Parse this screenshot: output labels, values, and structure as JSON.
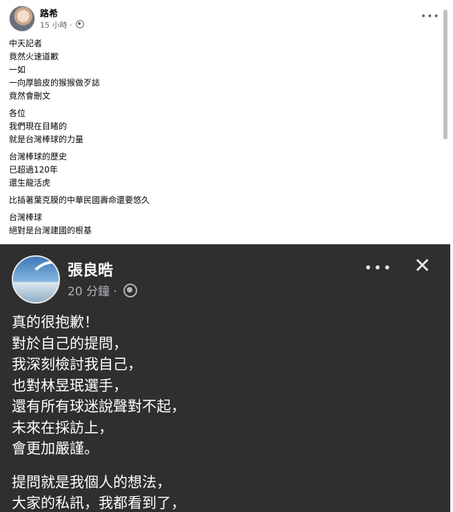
{
  "post": {
    "author": "路希",
    "time": "15 小時",
    "separator": "·",
    "more": "•••",
    "paragraphs": [
      [
        "中天記者",
        "竟然火速道歉",
        "一如",
        "一向厚臉皮的猴猴做歹誌",
        "竟然會刪文"
      ],
      [
        "各位",
        "我們現在目睹的",
        "就是台灣棒球的力量"
      ],
      [
        "台灣棒球的歷史",
        "已超過120年",
        "還生龍活虎"
      ],
      [
        "比插著葉克膜的中華民國壽命還要悠久"
      ],
      [
        "台灣棒球",
        "絕對是台灣建國的根基"
      ]
    ]
  },
  "photo": {
    "author": "張良晧",
    "time": "20 分鐘",
    "separator": "·",
    "more": "•••",
    "close": "✕",
    "paragraphs": [
      [
        "真的很抱歉！",
        "對於自己的提問，",
        "我深刻檢討我自己，",
        "也對林昱珉選手，",
        "還有所有球迷說聲對不起，",
        "未來在採訪上，",
        "會更加嚴謹。"
      ],
      [
        "提問就是我個人的想法，",
        "大家的私訊，我都看到了，"
      ]
    ]
  },
  "icons": {
    "globe": "globe-icon",
    "more": "more-options-icon",
    "close": "close-icon"
  },
  "colors": {
    "photo_background": "#2f2f30",
    "meta_gray": "#65676b"
  }
}
